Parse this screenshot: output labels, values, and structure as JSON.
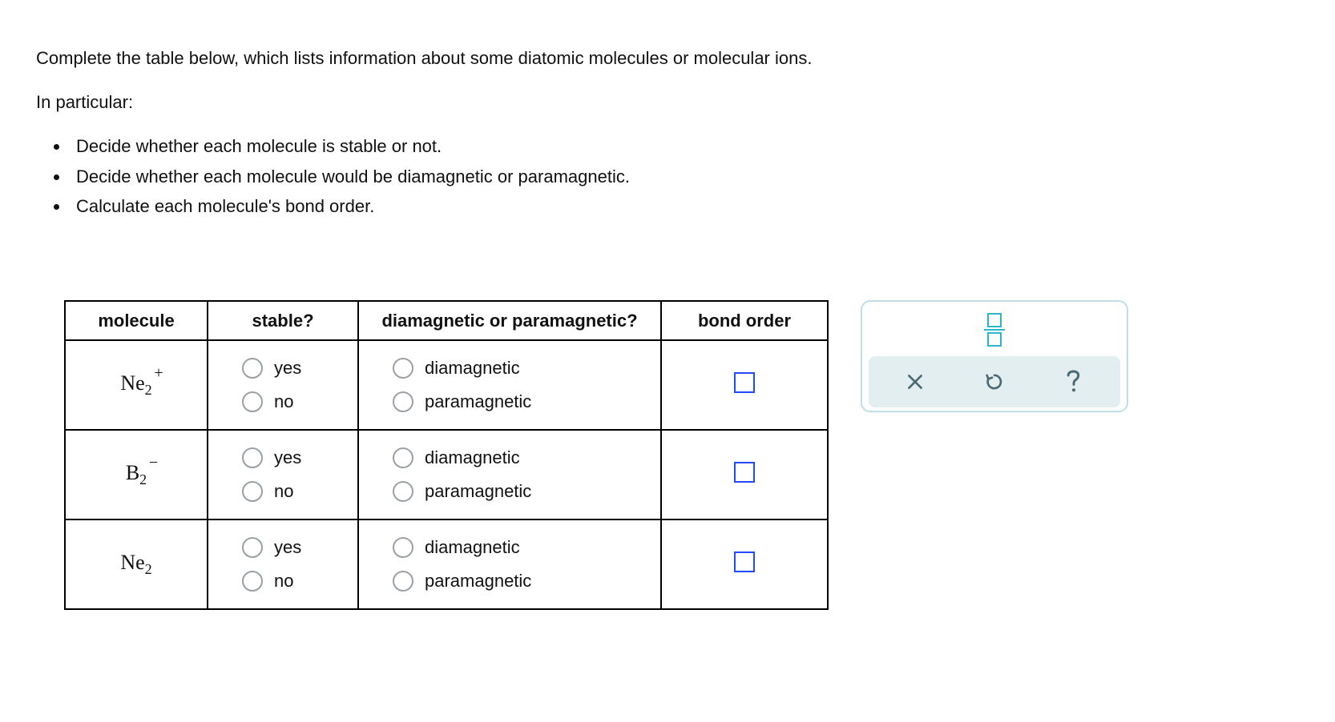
{
  "prompt": {
    "intro": "Complete the table below, which lists information about some diatomic molecules or molecular ions.",
    "in_particular": "In particular:",
    "bullets": [
      "Decide whether each molecule is stable or not.",
      "Decide whether each molecule would be diamagnetic or paramagnetic.",
      "Calculate each molecule's bond order."
    ]
  },
  "table": {
    "headers": {
      "molecule": "molecule",
      "stable": "stable?",
      "magnetism": "diamagnetic or paramagnetic?",
      "bond_order": "bond order"
    },
    "option_labels": {
      "yes": "yes",
      "no": "no",
      "diamagnetic": "diamagnetic",
      "paramagnetic": "paramagnetic"
    },
    "rows": [
      {
        "symbol": "Ne",
        "subscript": "2",
        "charge": "+"
      },
      {
        "symbol": "B",
        "subscript": "2",
        "charge": "−"
      },
      {
        "symbol": "Ne",
        "subscript": "2",
        "charge": ""
      }
    ]
  },
  "tools": {
    "fraction": "fraction-tool",
    "clear": "clear",
    "undo": "undo",
    "help": "help"
  }
}
